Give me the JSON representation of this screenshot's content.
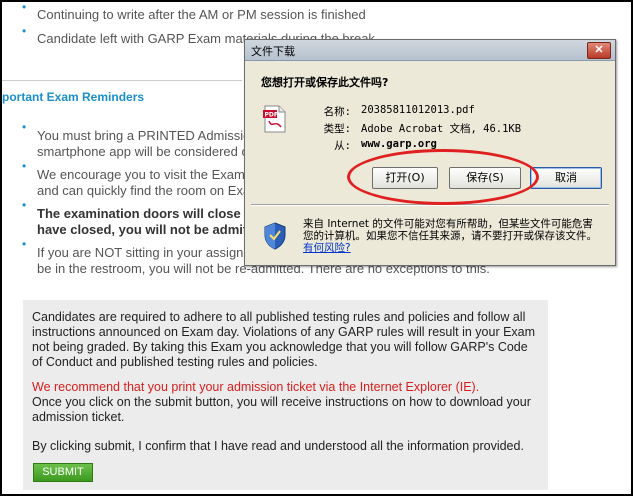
{
  "page": {
    "line_session": "Continuing to write after the AM or PM session is finished",
    "line_materials": "Candidate left with GARP Exam materials during the break",
    "section_heading": "portant Exam Reminders",
    "reminder1_line1": "You must bring a PRINTED Admission",
    "reminder1_line2": "smartphone app will be considered or a",
    "reminder2_line1": "We encourage you to visit the Exam s",
    "reminder2_line2": "and can quickly find the room on Exam",
    "reminder3_line1": "The examination doors will close at",
    "reminder3_line2": "have closed, you will not be admitte",
    "reminder4_line1": "If you are NOT sitting in your assigned",
    "reminder4_line2": "be in the restroom, you will not be re-admitted. There are no exceptions to this.",
    "rules_paragraph": "Candidates are required to adhere to all published testing rules and policies and follow all instructions announced on Exam day. Violations of any GARP rules will result in your Exam not being graded. By taking this Exam you acknowledge that you will follow GARP's Code of Conduct and published testing rules and policies.",
    "recommend_text": "We recommend that you print your admission ticket via the Internet Explorer (IE).",
    "submit_info": "Once you click on the submit button, you will receive instructions on how to download your admission ticket.",
    "confirm_text": "By clicking submit, I confirm that I have read and understood all the information provided.",
    "submit_label": "SUBMIT"
  },
  "dialog": {
    "title": "文件下载",
    "close_label": "✕",
    "question": "您想打开或保存此文件吗?",
    "name_label": "名称:",
    "name_value": "20385811012013.pdf",
    "type_label": "类型:",
    "type_value": "Adobe Acrobat 文档, 46.1KB",
    "from_label": "从:",
    "from_value": "www.garp.org",
    "open_label": "打开(O)",
    "save_label": "保存(S)",
    "cancel_label": "取消",
    "warning_text": "来自 Internet 的文件可能对您有所帮助，但某些文件可能危害您的计算机。如果您不信任其来源，请不要打开或保存该文件。",
    "risk_link": "有何风险?"
  },
  "colors": {
    "accent_blue": "#1a8fc9",
    "warning_red": "#d62020",
    "submit_green": "#4aa82a",
    "highlight_red": "#e02020"
  },
  "icons": [
    "pdf-file-icon",
    "security-shield-icon",
    "close-icon",
    "bullet-icon"
  ]
}
